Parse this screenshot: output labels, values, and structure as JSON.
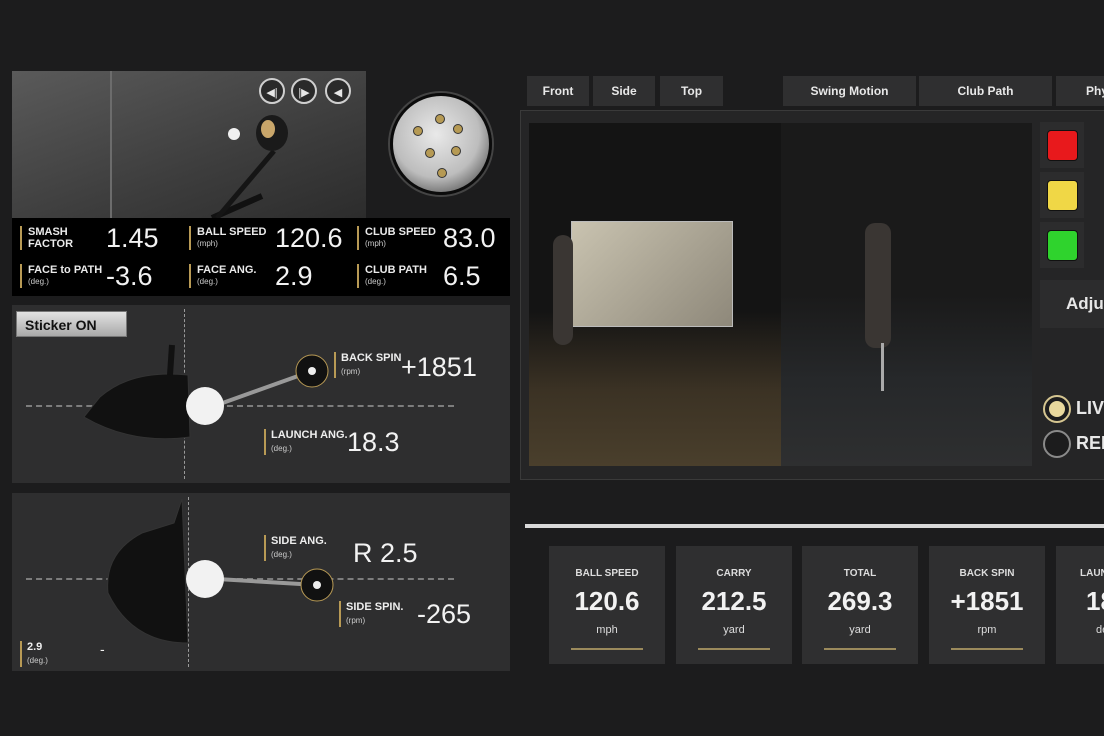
{
  "cam_controls": [
    "◀|",
    "|▶",
    "◀"
  ],
  "stats": {
    "smash": {
      "label1": "SMASH",
      "label2": "FACTOR",
      "value": "1.45"
    },
    "ball_speed": {
      "label": "BALL SPEED",
      "unit": "(mph)",
      "value": "120.6"
    },
    "club_speed": {
      "label": "CLUB SPEED",
      "unit": "(mph)",
      "value": "83.0"
    },
    "face_to_path": {
      "label": "FACE to PATH",
      "unit": "(deg.)",
      "value": "-3.6"
    },
    "face_ang": {
      "label": "FACE ANG.",
      "unit": "(deg.)",
      "value": "2.9"
    },
    "club_path": {
      "label": "CLUB PATH",
      "unit": "(deg.)",
      "value": "6.5"
    }
  },
  "sticker_label": "Sticker ON",
  "side_view": {
    "back_spin": {
      "label": "BACK SPIN",
      "unit": "(rpm)",
      "value": "+1851"
    },
    "launch": {
      "label": "LAUNCH ANG.",
      "unit": "(deg.)",
      "value": "18.3"
    }
  },
  "top_view": {
    "side_ang": {
      "label": "SIDE ANG.",
      "unit": "(deg.)",
      "value": "R 2.5"
    },
    "side_spin": {
      "label": "SIDE SPIN.",
      "unit": "(rpm)",
      "value": "-265"
    },
    "face_small": {
      "label": "2.9",
      "unit": "(deg.)",
      "value": "-"
    }
  },
  "tabs": [
    "Front",
    "Side",
    "Top",
    "Swing Motion",
    "Club Path",
    "Phy"
  ],
  "colors": {
    "red": "#e8191c",
    "yellow": "#f0d746",
    "green": "#2fd32d",
    "accent": "#b89a55"
  },
  "adjust_label": "Adju",
  "modes": [
    "LIV",
    "REI"
  ],
  "cards": [
    {
      "label": "BALL SPEED",
      "value": "120.6",
      "unit": "mph"
    },
    {
      "label": "CARRY",
      "value": "212.5",
      "unit": "yard"
    },
    {
      "label": "TOTAL",
      "value": "269.3",
      "unit": "yard"
    },
    {
      "label": "BACK SPIN",
      "value": "+1851",
      "unit": "rpm"
    },
    {
      "label": "LAUN",
      "value": "18",
      "unit": "de"
    }
  ]
}
